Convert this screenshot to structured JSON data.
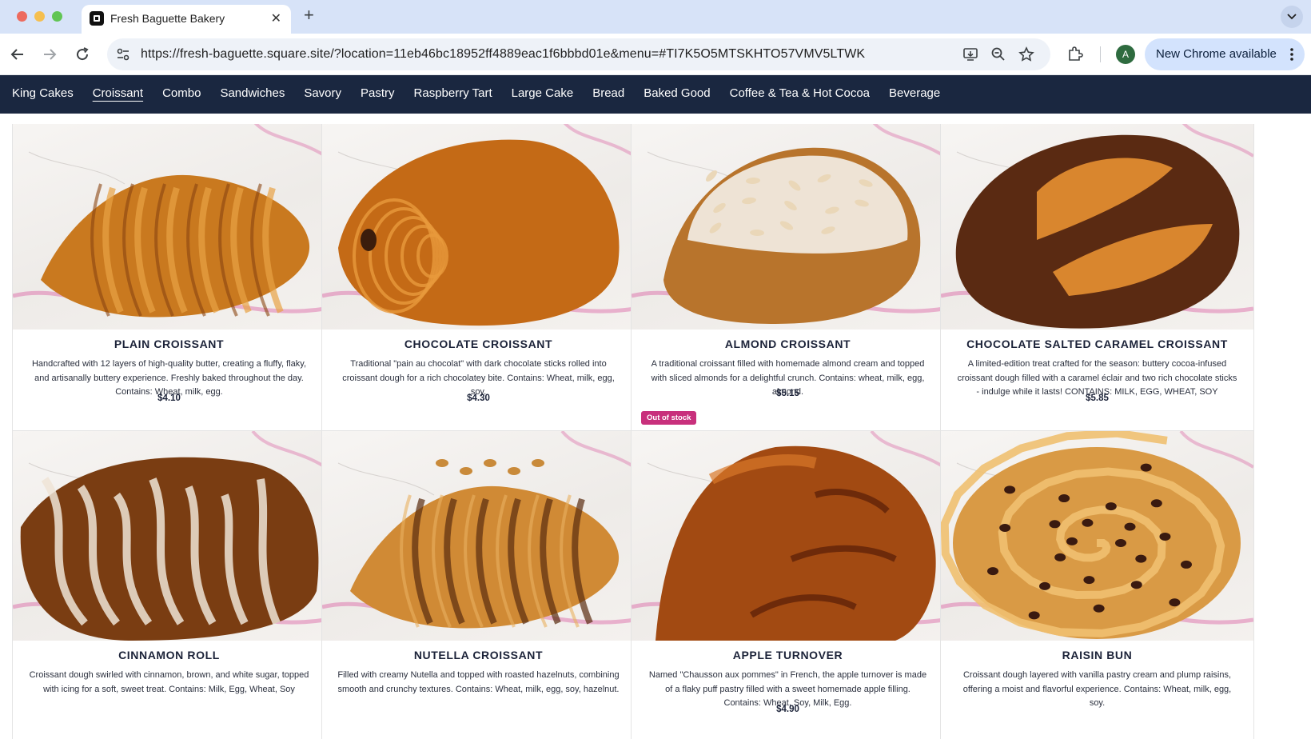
{
  "browser": {
    "tab_title": "Fresh Baguette Bakery",
    "url": "https://fresh-baguette.square.site/?location=11eb46bc18952ff4889eac1f6bbbd01e&menu=#TI7K5O5MTSKHTO57VMV5LTWK",
    "profile_initial": "A",
    "update_label": "New Chrome available"
  },
  "nav": {
    "active_index": 1,
    "items": [
      "King Cakes",
      "Croissant",
      "Combo",
      "Sandwiches",
      "Savory",
      "Pastry",
      "Raspberry Tart",
      "Large Cake",
      "Bread",
      "Baked Good",
      "Coffee & Tea & Hot Cocoa",
      "Beverage"
    ]
  },
  "products": [
    {
      "name": "PLAIN CROISSANT",
      "description": "Handcrafted with 12 layers of high-quality butter, creating a fluffy, flaky, and artisanally buttery experience. Freshly baked throughout the day. Contains: Wheat, milk, egg.",
      "price": "$4.10",
      "badge": "",
      "image": "croissant",
      "colors": [
        "#c9791f",
        "#e8a245",
        "#8a4510"
      ]
    },
    {
      "name": "CHOCOLATE CROISSANT",
      "description": "Traditional \"pain au chocolat\" with dark chocolate sticks rolled into croissant dough for a rich chocolatey bite. Contains: Wheat, milk, egg, soy.",
      "price": "$4.30",
      "badge": "",
      "image": "pain-au-chocolat",
      "colors": [
        "#c46a16",
        "#e89a3c",
        "#3b1d0c"
      ]
    },
    {
      "name": "ALMOND CROISSANT",
      "description": "A traditional croissant filled with homemade almond cream and topped with sliced almonds for a delightful crunch. Contains: wheat, milk, egg, almond.",
      "price": "$5.15",
      "badge": "Out of stock",
      "image": "almond-croissant",
      "colors": [
        "#b8742c",
        "#f4efe8",
        "#8a4d18"
      ]
    },
    {
      "name": "CHOCOLATE SALTED CARAMEL CROISSANT",
      "description": "A limited-edition treat crafted for the season: buttery cocoa-infused croissant dough filled with a caramel éclair and two rich chocolate sticks - indulge while it lasts! CONTAINS: MILK, EGG, WHEAT, SOY",
      "price": "$5.85",
      "badge": "",
      "image": "cocoa-croissant",
      "colors": [
        "#5a2a12",
        "#d9862e",
        "#2d140a"
      ]
    },
    {
      "name": "CINNAMON ROLL",
      "description": "Croissant dough swirled with cinnamon, brown, and white sugar, topped with icing for a soft, sweet treat. Contains: Milk, Egg, Wheat, Soy",
      "price": "",
      "badge": "",
      "image": "cinnamon-roll",
      "colors": [
        "#7a3d12",
        "#efe4d6",
        "#c97a2c"
      ]
    },
    {
      "name": "NUTELLA CROISSANT",
      "description": "Filled with creamy Nutella and topped with roasted hazelnuts, combining smooth and crunchy textures.  Contains: Wheat, milk, egg, soy, hazelnut.",
      "price": "",
      "badge": "",
      "image": "nutella-croissant",
      "colors": [
        "#d08a35",
        "#5a2c10",
        "#e9b060"
      ]
    },
    {
      "name": "APPLE TURNOVER",
      "description": "Named \"Chausson aux pommes\" in French, the apple turnover is made of a flaky puff pastry filled with a sweet homemade apple filling. Contains: Wheat, Soy, Milk, Egg.",
      "price": "$4.90",
      "badge": "",
      "image": "apple-turnover",
      "colors": [
        "#a24a12",
        "#d9782a",
        "#6d2a0a"
      ]
    },
    {
      "name": "RAISIN BUN",
      "description": "Croissant dough layered with vanilla pastry cream and plump raisins, offering a moist and flavorful experience. Contains: Wheat, milk, egg, soy.",
      "price": "",
      "badge": "",
      "image": "raisin-bun",
      "colors": [
        "#d99a45",
        "#f0c070",
        "#3a1a10"
      ]
    }
  ]
}
